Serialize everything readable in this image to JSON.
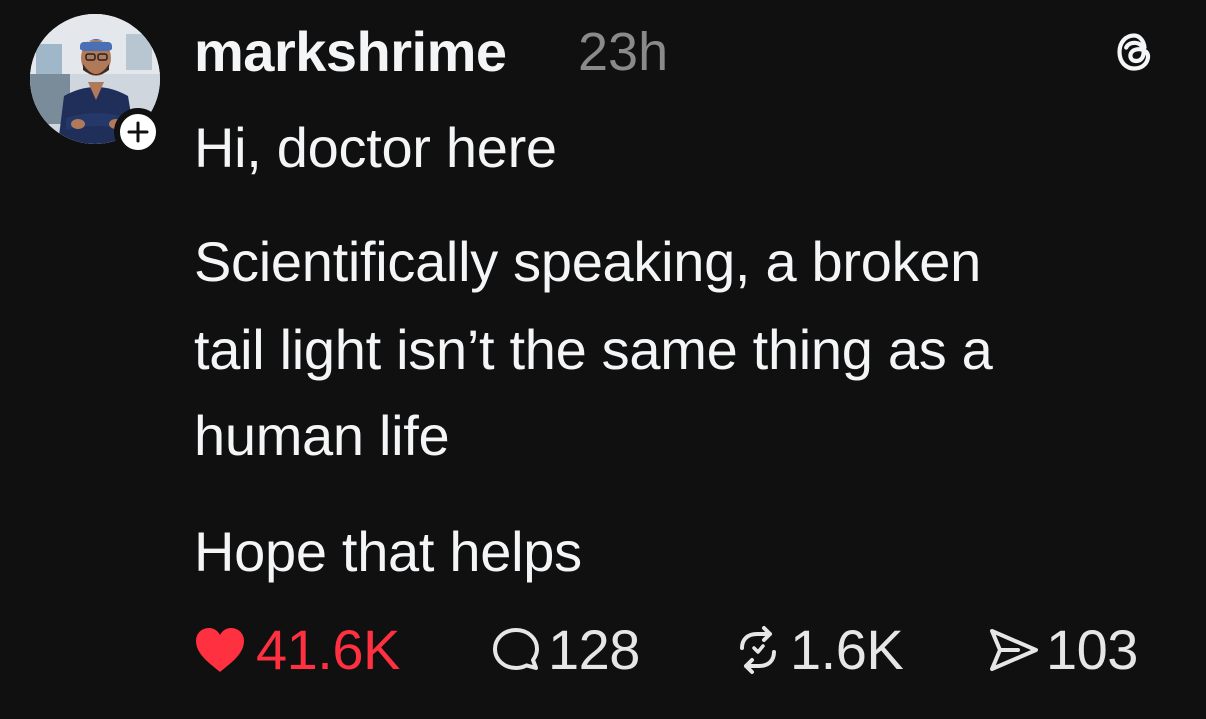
{
  "post": {
    "username": "markshrime",
    "timestamp": "23h",
    "paragraphs": [
      [
        "Hi, doctor here"
      ],
      [
        "Scientifically speaking, a broken",
        "tail light isn’t the same thing as a",
        "human life"
      ],
      [
        "Hope that helps"
      ]
    ],
    "line_1": "Hi, doctor here",
    "line_2": "Scientifically speaking, a broken",
    "line_3": "tail light isn’t the same thing as a",
    "line_4": "human life",
    "line_5": "Hope that helps"
  },
  "actions": {
    "likes": "41.6K",
    "replies": "128",
    "reposts": "1.6K",
    "shares": "103"
  },
  "icons": {
    "avatar": "avatar-photo",
    "follow": "plus-icon",
    "app": "threads-logo-icon",
    "like": "heart-icon",
    "reply": "comment-icon",
    "repost": "repost-icon",
    "share": "send-icon"
  },
  "colors": {
    "background": "#101010",
    "text": "#f3f5f7",
    "muted": "#8a8a8a",
    "like": "#ff3040"
  },
  "state": {
    "liked": true
  }
}
